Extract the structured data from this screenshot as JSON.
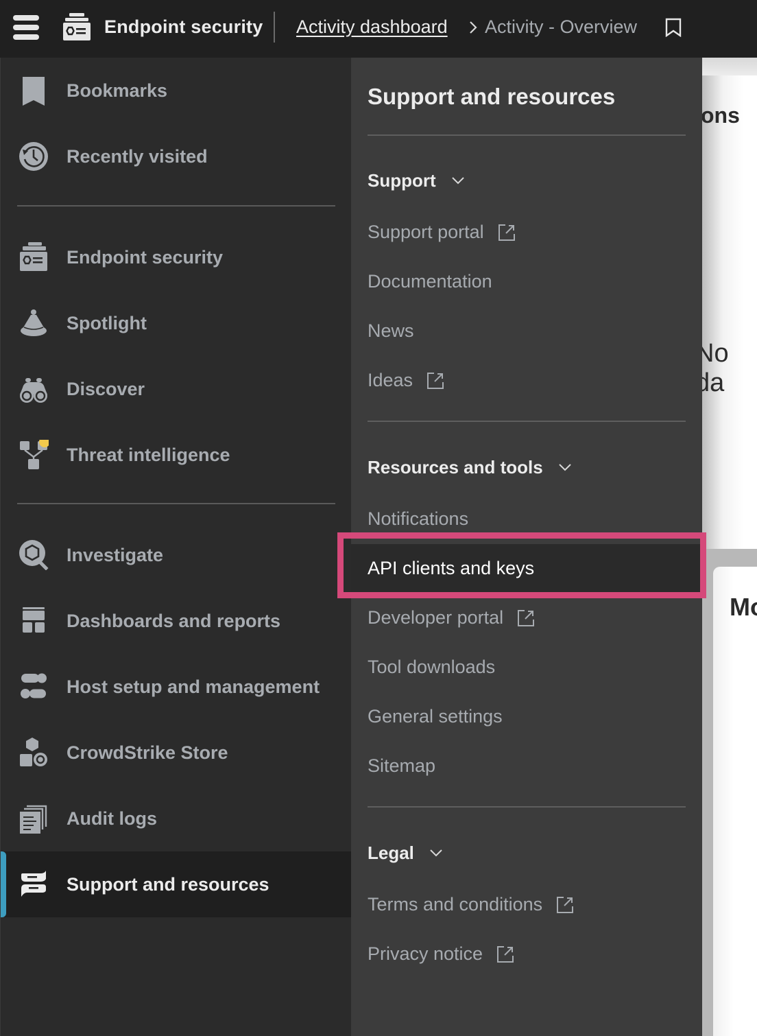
{
  "topbar": {
    "menu_icon": "hamburger-menu-icon",
    "app_icon": "endpoint-security-icon",
    "app_title": "Endpoint security",
    "breadcrumb": {
      "parent": "Activity dashboard",
      "separator_icon": "chevron-right-icon",
      "current": "Activity - Overview"
    },
    "bookmark_icon": "bookmark-outline-icon"
  },
  "sidebar": {
    "items": [
      {
        "label": "Bookmarks",
        "icon": "bookmark-icon"
      },
      {
        "label": "Recently visited",
        "icon": "history-clock-icon"
      },
      {
        "label": "Endpoint security",
        "icon": "endpoint-security-icon"
      },
      {
        "label": "Spotlight",
        "icon": "spotlight-icon"
      },
      {
        "label": "Discover",
        "icon": "binoculars-icon"
      },
      {
        "label": "Threat intelligence",
        "icon": "threat-intel-icon",
        "badge_color": "#f2c94c"
      },
      {
        "label": "Investigate",
        "icon": "investigate-search-icon"
      },
      {
        "label": "Dashboards and reports",
        "icon": "dashboard-layout-icon"
      },
      {
        "label": "Host setup and management",
        "icon": "toggles-icon"
      },
      {
        "label": "CrowdStrike Store",
        "icon": "store-shapes-icon"
      },
      {
        "label": "Audit logs",
        "icon": "documents-stack-icon"
      },
      {
        "label": "Support and resources",
        "icon": "support-chat-icon",
        "active": true
      }
    ],
    "active_accent_color": "#3d9dbf"
  },
  "flyout": {
    "title": "Support and resources",
    "sections": [
      {
        "heading": "Support",
        "items": [
          {
            "label": "Support portal",
            "external": true
          },
          {
            "label": "Documentation",
            "external": false
          },
          {
            "label": "News",
            "external": false
          },
          {
            "label": "Ideas",
            "external": true
          }
        ]
      },
      {
        "heading": "Resources and tools",
        "items": [
          {
            "label": "Notifications",
            "external": false
          },
          {
            "label": "API clients and keys",
            "external": false,
            "selected": true
          },
          {
            "label": "Developer portal",
            "external": true
          },
          {
            "label": "Tool downloads",
            "external": false
          },
          {
            "label": "General settings",
            "external": false
          },
          {
            "label": "Sitemap",
            "external": false
          }
        ]
      },
      {
        "heading": "Legal",
        "items": [
          {
            "label": "Terms and conditions",
            "external": true
          },
          {
            "label": "Privacy notice",
            "external": true
          }
        ]
      }
    ],
    "highlight_color": "#d5497a"
  },
  "background_page": {
    "card1_heading_fragment": "ons",
    "card1_empty_fragment": "No da",
    "card2_heading_fragment": "Mo"
  }
}
